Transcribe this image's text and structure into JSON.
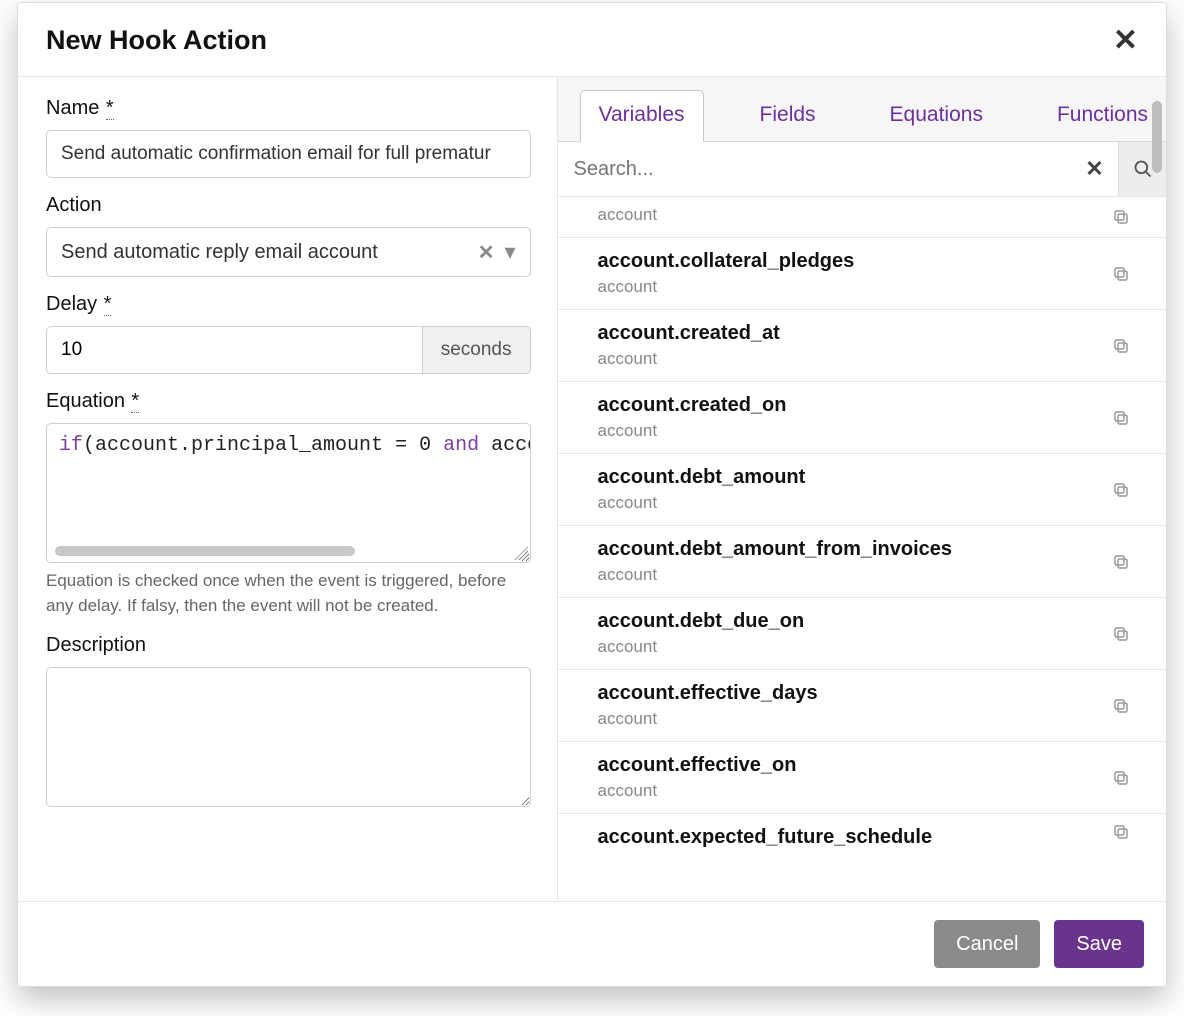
{
  "title": "New Hook Action",
  "fields": {
    "name_label": "Name",
    "name_value": "Send automatic confirmation email for full prematur",
    "action_label": "Action",
    "action_value": "Send automatic reply email account",
    "delay_label": "Delay",
    "delay_value": "10",
    "delay_unit": "seconds",
    "equation_label": "Equation",
    "equation_tokens": {
      "kw1": "if",
      "t1": "(account.principal_amount = 0 ",
      "kw2": "and",
      "t2": " accou"
    },
    "equation_help": "Equation is checked once when the event is triggered, before any delay. If falsy, then the event will not be created.",
    "desc_label": "Description",
    "desc_value": ""
  },
  "search_placeholder": "Search...",
  "tabs": {
    "t1": "Variables",
    "t2": "Fields",
    "t3": "Equations",
    "t4": "Functions"
  },
  "variables": [
    {
      "name": "",
      "context": "account",
      "first_partial": true
    },
    {
      "name": "account.collateral_pledges",
      "context": "account"
    },
    {
      "name": "account.created_at",
      "context": "account"
    },
    {
      "name": "account.created_on",
      "context": "account"
    },
    {
      "name": "account.debt_amount",
      "context": "account"
    },
    {
      "name": "account.debt_amount_from_invoices",
      "context": "account"
    },
    {
      "name": "account.debt_due_on",
      "context": "account"
    },
    {
      "name": "account.effective_days",
      "context": "account"
    },
    {
      "name": "account.effective_on",
      "context": "account"
    },
    {
      "name": "account.expected_future_schedule",
      "context": "",
      "last_partial": true
    }
  ],
  "footer": {
    "cancel": "Cancel",
    "save": "Save"
  }
}
